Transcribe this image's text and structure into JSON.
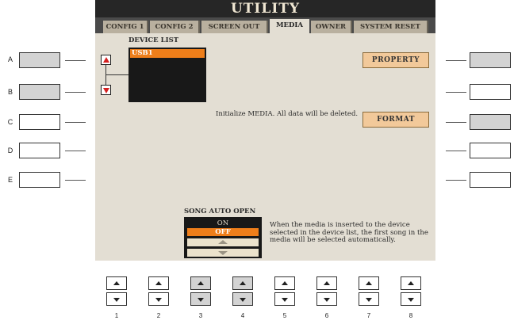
{
  "screen": {
    "title": "UTILITY",
    "tabs": [
      {
        "label": "CONFIG 1",
        "active": false
      },
      {
        "label": "CONFIG 2",
        "active": false
      },
      {
        "label": "SCREEN OUT",
        "active": false
      },
      {
        "label": "MEDIA",
        "active": true
      },
      {
        "label": "OWNER",
        "active": false
      },
      {
        "label": "SYSTEM RESET",
        "active": false
      }
    ],
    "device_list": {
      "label": "DEVICE LIST",
      "items": [
        "USB1"
      ],
      "selected": "USB1"
    },
    "property_button": "PROPERTY",
    "init_message": "Initialize MEDIA. All data will be deleted.",
    "format_button": "FORMAT",
    "song_auto_open": {
      "label": "SONG AUTO OPEN",
      "options": [
        "ON",
        "OFF"
      ],
      "selected": "OFF",
      "description": "When the media is inserted to the device selected in the device list, the first song in the media will be selected automatically."
    }
  },
  "side_buttons": {
    "left": [
      "A",
      "B",
      "C",
      "D",
      "E"
    ],
    "lit": [
      "A",
      "B",
      "right-A",
      "right-C"
    ]
  },
  "bottom_buttons": {
    "numbers": [
      "1",
      "2",
      "3",
      "4",
      "5",
      "6",
      "7",
      "8"
    ],
    "lit": [
      "3",
      "4"
    ]
  },
  "colors": {
    "screen_bg": "#e3ded3",
    "title_bar": "#262626",
    "highlight": "#ee7e1a",
    "button_fill": "#f2c99a",
    "lit_button": "#d3d3d3"
  }
}
